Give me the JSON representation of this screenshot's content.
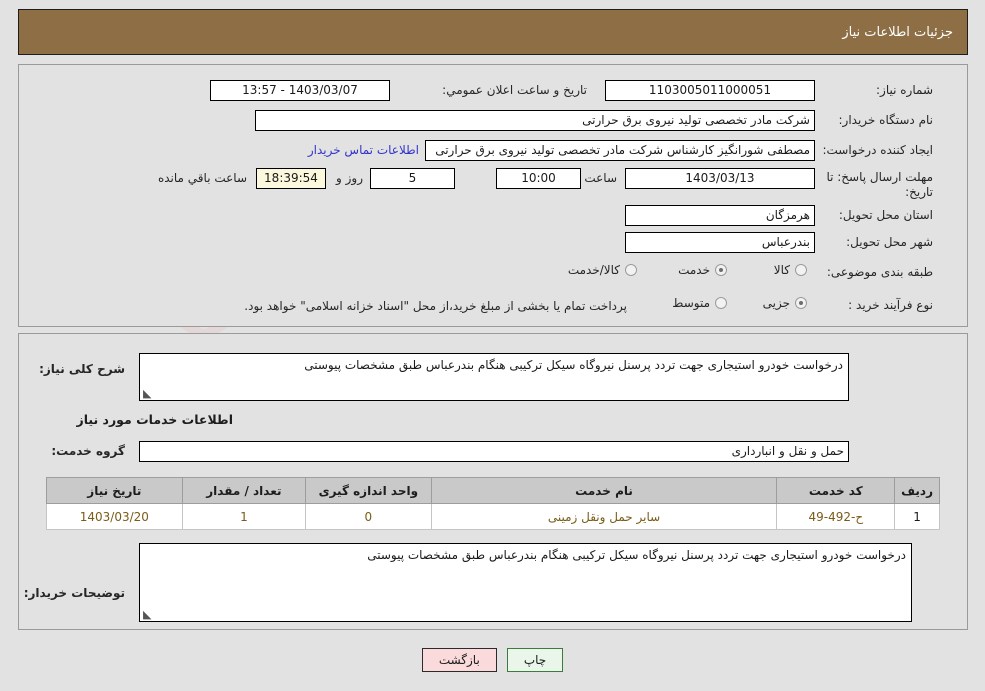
{
  "header": {
    "title": "جزئیات اطلاعات نیاز"
  },
  "colors": {
    "header_bg": "#8d6e45",
    "page_bg": "#e2e2e2",
    "panel_border": "#9a9a9a",
    "link": "#3333cc",
    "table_header_bg": "#c9c9c9",
    "table_cell_text": "#7a5c18",
    "back_button_bg": "#fadada",
    "print_button_bg": "#e9f6e9",
    "highlight_field_bg": "#fbf8dd"
  },
  "watermark": {
    "text": "AriaTender.net"
  },
  "top_form": {
    "need_number": {
      "label": "شماره نیاز:",
      "value": "1103005011000051"
    },
    "announce_datetime": {
      "label": "تاریخ و ساعت اعلان عمومي:",
      "value": "1403/03/07 - 13:57"
    },
    "buyer_org": {
      "label": "نام دستگاه خریدار:",
      "value": "شرکت مادر تخصصی تولید نیروی برق حرارتی"
    },
    "requester": {
      "label": "ایجاد کننده درخواست:",
      "value": "مصطفی شورانگیز کارشناس شرکت مادر تخصصی تولید نیروی برق حرارتی",
      "contact_link": "اطلاعات تماس خریدار"
    },
    "deadline": {
      "label": "مهلت ارسال پاسخ: تا تاریخ:",
      "date": "1403/03/13",
      "time_label": "ساعت",
      "time": "10:00",
      "days": "5",
      "days_label": "روز و",
      "countdown": "18:39:54",
      "countdown_label": "ساعت باقي مانده"
    },
    "province": {
      "label": "استان محل تحویل:",
      "value": "هرمزگان"
    },
    "city": {
      "label": "شهر محل تحویل:",
      "value": "بندرعباس"
    },
    "subject_category": {
      "label": "طبقه بندی موضوعی:",
      "options": [
        {
          "label": "کالا",
          "selected": false
        },
        {
          "label": "خدمت",
          "selected": true
        },
        {
          "label": "کالا/خدمت",
          "selected": false
        }
      ]
    },
    "purchase_process": {
      "label": "نوع فرآیند خرید :",
      "options": [
        {
          "label": "جزیی",
          "selected": true
        },
        {
          "label": "متوسط",
          "selected": false
        },
        {
          "label": "پرداخت تمام یا بخشی از مبلغ خرید،از محل \"اسناد خزانه اسلامی\" خواهد بود.",
          "selected": false
        }
      ]
    }
  },
  "middle": {
    "general_description": {
      "label": "شرح کلی نیاز:",
      "value": "درخواست خودرو استیجاری جهت تردد پرسنل نیروگاه سیکل ترکیبی هنگام بندرعباس طبق مشخصات پیوستی"
    },
    "services_section_title": "اطلاعات خدمات مورد نیاز",
    "service_group": {
      "label": "گروه خدمت:",
      "value": "حمل و نقل و انبارداری"
    },
    "table": {
      "columns": [
        "ردیف",
        "کد خدمت",
        "نام خدمت",
        "واحد اندازه گیری",
        "تعداد / مقدار",
        "تاریخ نیاز"
      ],
      "rows": [
        {
          "row": "1",
          "service_code": "ح-492-49",
          "service_name": "سایر حمل ونقل زمینی",
          "unit": "0",
          "quantity": "1",
          "need_date": "1403/03/20"
        }
      ]
    },
    "buyer_notes": {
      "label": "توضیحات خریدار:",
      "value": "درخواست خودرو استیجاری جهت تردد پرسنل نیروگاه سیکل ترکیبی هنگام بندرعباس طبق مشخصات پیوستی"
    }
  },
  "footer": {
    "print_button": "چاپ",
    "back_button": "بازگشت"
  }
}
